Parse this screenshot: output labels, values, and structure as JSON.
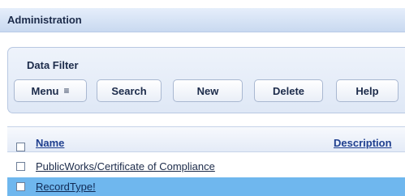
{
  "header": {
    "title": "Administration"
  },
  "filter": {
    "title": "Data Filter",
    "buttons": {
      "menu": "Menu",
      "menu_icon": "≡",
      "search": "Search",
      "new": "New",
      "delete": "Delete",
      "help": "Help"
    }
  },
  "table": {
    "columns": {
      "name": "Name",
      "description": "Description"
    },
    "rows": [
      {
        "name": "PublicWorks/Certificate of Compliance",
        "selected": false
      },
      {
        "name": "RecordType!",
        "selected": true
      }
    ]
  },
  "colors": {
    "selected_row": "#6fb7ee",
    "header_bar": "#c9d9f0",
    "link": "#1f3f8f"
  }
}
